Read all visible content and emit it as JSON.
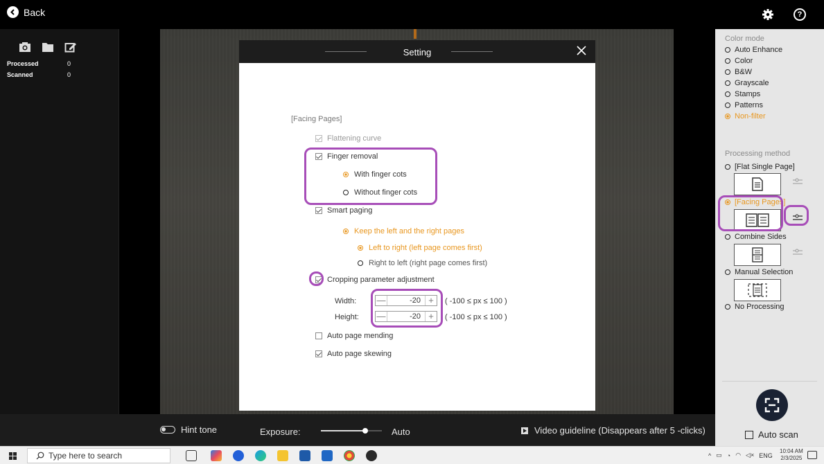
{
  "topbar": {
    "back_label": "Back"
  },
  "left_panel": {
    "processed_label": "Processed",
    "processed_count": "0",
    "scanned_label": "Scanned",
    "scanned_count": "0"
  },
  "dialog": {
    "title": "Setting",
    "section_title": "[Facing Pages]",
    "flattening_curve": "Flattening curve",
    "finger_removal": "Finger removal",
    "with_finger_cots": "With finger cots",
    "without_finger_cots": "Without finger cots",
    "smart_paging": "Smart paging",
    "keep_left_right": "Keep the left and the right pages",
    "left_to_right": "Left to right (left page comes first)",
    "right_to_left": "Right to left (right page comes first)",
    "cropping_adjust": "Cropping parameter adjustment",
    "width_label": "Width:",
    "width_value": "-20",
    "height_label": "Height:",
    "height_value": "-20",
    "range_note": "( -100 ≤ px ≤ 100 )",
    "auto_mending": "Auto page mending",
    "auto_skewing": "Auto page skewing"
  },
  "right_panel": {
    "color_mode_heading": "Color mode",
    "color_modes": [
      "Auto Enhance",
      "Color",
      "B&W",
      "Grayscale",
      "Stamps",
      "Patterns",
      "Non-filter"
    ],
    "processing_heading": "Processing method",
    "methods": [
      "[Flat Single Page]",
      "[Facing Pages]",
      "Combine Sides",
      "Manual Selection",
      "No Processing"
    ],
    "auto_scan": "Auto scan"
  },
  "bottombar": {
    "hint_tone": "Hint tone",
    "exposure_label": "Exposure:",
    "exposure_auto": "Auto",
    "exposure_level": 0.73,
    "video_guideline": "Video guideline  (Disappears after 5 -clicks)"
  },
  "taskbar": {
    "search_placeholder": "Type here to search",
    "lang": "ENG",
    "time": "10:04 AM",
    "date": "2/3/2025"
  },
  "colors": {
    "accent": "#e8961e",
    "highlight": "#a74db8"
  }
}
